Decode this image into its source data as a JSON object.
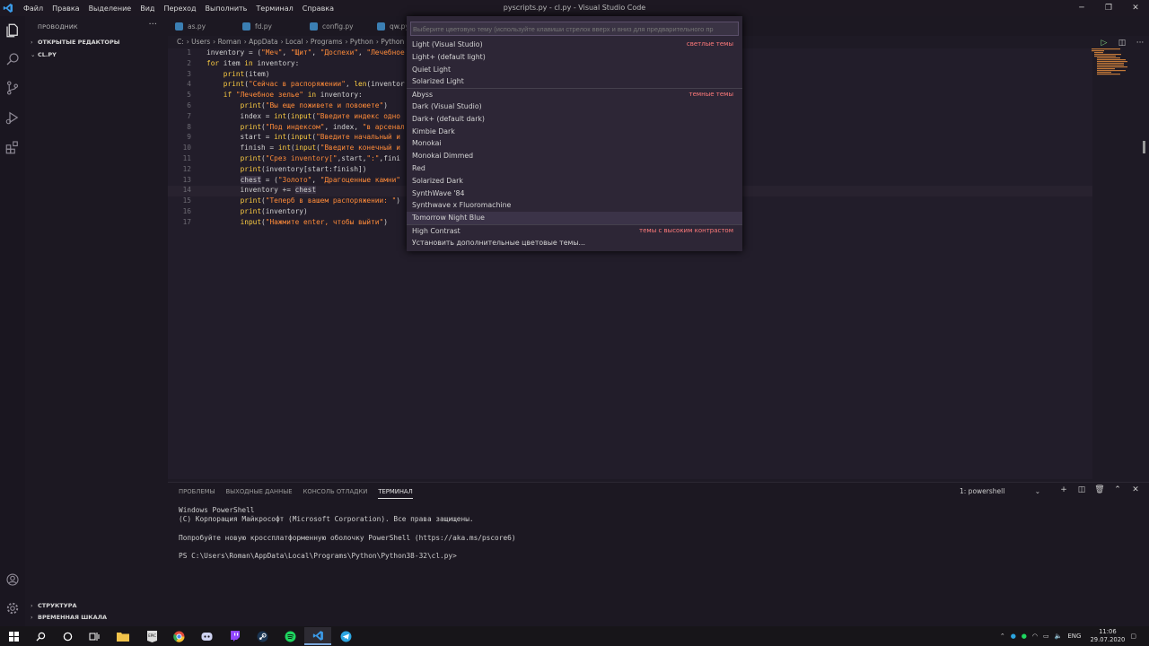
{
  "window": {
    "title": "pyscripts.py - cl.py - Visual Studio Code",
    "menus": [
      "Файл",
      "Правка",
      "Выделение",
      "Вид",
      "Переход",
      "Выполнить",
      "Терминал",
      "Справка"
    ]
  },
  "sidebar": {
    "title": "ПРОВОДНИК",
    "sections": {
      "open_editors": "ОТКРЫТЫЕ РЕДАКТОРЫ",
      "folder": "CL.PY",
      "outline": "СТРУКТУРА",
      "timeline": "ВРЕМЕННАЯ ШКАЛА"
    }
  },
  "tabs": [
    "as.py",
    "fd.py",
    "config.py",
    "qw.py"
  ],
  "breadcrumb": [
    "C:",
    "Users",
    "Roman",
    "AppData",
    "Local",
    "Programs",
    "Python",
    "Python"
  ],
  "code": [
    {
      "n": "1",
      "text": "inventory = (\"Меч\", \"Щит\", \"Доспехи\", \"Лечебное"
    },
    {
      "n": "2",
      "text": "for item in inventory:"
    },
    {
      "n": "3",
      "text": "    print(item)"
    },
    {
      "n": "4",
      "text": "    print(\"Сейчас в распоряжении\", len(inventor"
    },
    {
      "n": "5",
      "text": "    if \"Лечебное зелье\" in inventory:"
    },
    {
      "n": "6",
      "text": "        print(\"Вы еще поживете и повоюете\")"
    },
    {
      "n": "7",
      "text": "        index = int(input(\"Введите индекс одно"
    },
    {
      "n": "8",
      "text": "        print(\"Под индексом\", index, \"в арсенал"
    },
    {
      "n": "9",
      "text": "        start = int(input(\"Введите начальный и"
    },
    {
      "n": "10",
      "text": "        finish = int(input(\"Введите конечный и"
    },
    {
      "n": "11",
      "text": "        print(\"Срез inventory[\",start,\":\",fini"
    },
    {
      "n": "12",
      "text": "        print(inventory[start:finish])"
    },
    {
      "n": "13",
      "text": "        chest = (\"Золото\", \"Драгоценные камни\""
    },
    {
      "n": "14",
      "text": "        inventory += chest"
    },
    {
      "n": "15",
      "text": "        print(\"Теперб в вашем распоряжении: \")"
    },
    {
      "n": "16",
      "text": "        print(inventory)"
    },
    {
      "n": "17",
      "text": "        input(\"Нажмите enter, чтобы выйти\")"
    }
  ],
  "quickpick": {
    "placeholder": "Выберите цветовую тему (используйте клавиши стрелок вверх и вниз для предварительного пр",
    "items": [
      {
        "label": "Light (Visual Studio)",
        "group": "светлые темы"
      },
      {
        "label": "Light+ (default light)",
        "group": ""
      },
      {
        "label": "Quiet Light",
        "group": ""
      },
      {
        "label": "Solarized Light",
        "group": ""
      },
      {
        "label": "Abyss",
        "group": "темные темы"
      },
      {
        "label": "Dark (Visual Studio)",
        "group": ""
      },
      {
        "label": "Dark+ (default dark)",
        "group": ""
      },
      {
        "label": "Kimbie Dark",
        "group": ""
      },
      {
        "label": "Monokai",
        "group": ""
      },
      {
        "label": "Monokai Dimmed",
        "group": ""
      },
      {
        "label": "Red",
        "group": ""
      },
      {
        "label": "Solarized Dark",
        "group": ""
      },
      {
        "label": "SynthWave '84",
        "group": ""
      },
      {
        "label": "Synthwave x Fluoromachine",
        "group": ""
      },
      {
        "label": "Tomorrow Night Blue",
        "group": ""
      },
      {
        "label": "High Contrast",
        "group": "темы с высоким контрастом"
      },
      {
        "label": "Установить дополнительные цветовые темы...",
        "group": ""
      }
    ]
  },
  "panel": {
    "tabs": [
      "ПРОБЛЕМЫ",
      "ВЫХОДНЫЕ ДАННЫЕ",
      "КОНСОЛЬ ОТЛАДКИ",
      "ТЕРМИНАЛ"
    ],
    "terminal_select": "1: powershell",
    "terminal_lines": [
      "Windows PowerShell",
      "(C) Корпорация Майкрософт (Microsoft Corporation). Все права защищены.",
      "",
      "Попробуйте новую кроссплатформенную оболочку PowerShell (https://aka.ms/pscore6)",
      "",
      "PS C:\\Users\\Roman\\AppData\\Local\\Programs\\Python\\Python38-32\\cl.py>"
    ]
  },
  "taskbar": {
    "lang": "ENG",
    "time": "11:06",
    "date": "29.07.2020",
    "apps": [
      "file-explorer",
      "epic-games",
      "chrome",
      "discord",
      "twitch",
      "steam",
      "spotify",
      "vscode",
      "telegram"
    ]
  },
  "colors": {
    "accent": "#ffcf42",
    "string": "#ff8b39",
    "group_label": "#ff7a7a",
    "background": "#221d2a"
  }
}
